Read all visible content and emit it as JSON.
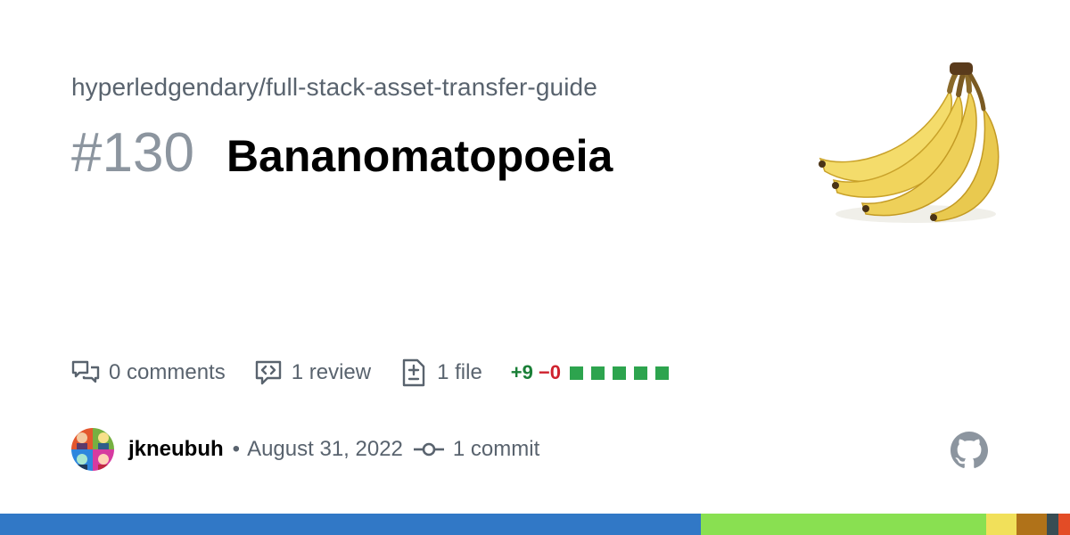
{
  "repo": {
    "full_name": "hyperledgendary/full-stack-asset-transfer-guide"
  },
  "pull_request": {
    "number": "#130",
    "title": "Bananomatopoeia"
  },
  "stats": {
    "comments": "0 comments",
    "reviews": "1 review",
    "files": "1 file",
    "additions": "+9",
    "deletions": "−0",
    "diff_blocks_green": 5
  },
  "meta": {
    "author": "jkneubuh",
    "separator": "•",
    "date": "August 31, 2022",
    "commits": "1 commit"
  },
  "icons": {
    "comments": "comment-discussion-icon",
    "review": "code-review-icon",
    "file": "file-diff-icon",
    "commit": "git-commit-icon",
    "logo": "github-mark-icon"
  },
  "colors": {
    "muted_text": "#59636e",
    "number": "#8c959f",
    "additions": "#1a7f37",
    "deletions": "#cf222e",
    "diff_square": "#2da44e"
  },
  "language_bar": [
    {
      "color": "#3178c6",
      "fraction": 0.655
    },
    {
      "color": "#89e051",
      "fraction": 0.267
    },
    {
      "color": "#f1e05a",
      "fraction": 0.028
    },
    {
      "color": "#b07219",
      "fraction": 0.028
    },
    {
      "color": "#384d54",
      "fraction": 0.011
    },
    {
      "color": "#e34c26",
      "fraction": 0.011
    }
  ]
}
